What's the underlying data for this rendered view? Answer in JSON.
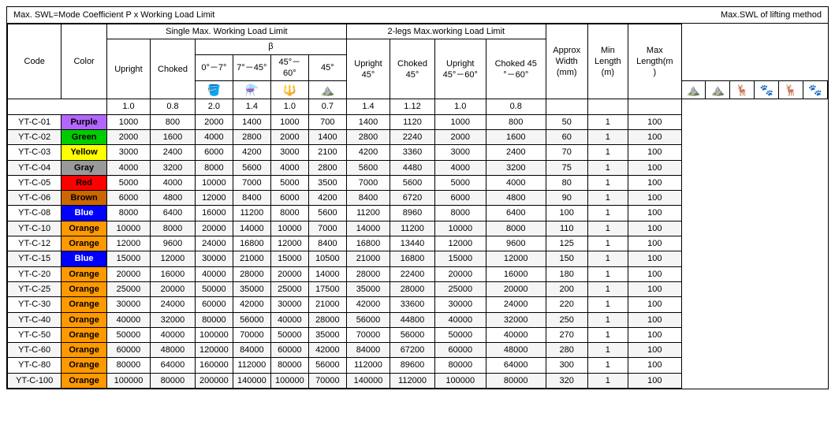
{
  "title_left": "Max. SWL=Mode Coefficient P x Working Load Limit",
  "title_right": "Max.SWL of lifting method",
  "headers": {
    "code": "Code",
    "color": "Color",
    "single_max": "Single Max. Working Load Limit",
    "two_legs": "2-legs Max.working Load Limit",
    "beta": "β",
    "upright": "Upright",
    "choked": "Choked",
    "upright_45": "Upright\n45°",
    "choked_45": "Choked\n45°",
    "upright_45_60": "Upright\n45°－60°",
    "choked_45_60": "Choked 45\n°－60°",
    "approx_width": "Approx\nWidth\n(mm)",
    "min_length": "Min\nLength\n(m)",
    "max_length": "Max\nLength(m\n)"
  },
  "angle_headers": {
    "a1": "0°－7°",
    "a2": "7°－45°",
    "a3": "45°－60°",
    "a4": "45°"
  },
  "coefficients": {
    "upright": "1.0",
    "choked": "0.8",
    "a1": "2.0",
    "a2": "1.4",
    "a3": "1.0",
    "a4": "0.7",
    "up45": "1.4",
    "ch45": "1.12",
    "up4560": "1.0",
    "ch4560": "0.8"
  },
  "rows": [
    {
      "code": "YT-C-01",
      "color": "Purple",
      "color_class": "color-purple",
      "upright": "1000",
      "choked": "800",
      "a1": "2000",
      "a2": "1400",
      "a3": "1000",
      "a4": "700",
      "up45": "1400",
      "ch45": "1120",
      "up4560": "1000",
      "ch4560": "800",
      "width": "50",
      "min_len": "1",
      "max_len": "100"
    },
    {
      "code": "YT-C-02",
      "color": "Green",
      "color_class": "color-green",
      "upright": "2000",
      "choked": "1600",
      "a1": "4000",
      "a2": "2800",
      "a3": "2000",
      "a4": "1400",
      "up45": "2800",
      "ch45": "2240",
      "up4560": "2000",
      "ch4560": "1600",
      "width": "60",
      "min_len": "1",
      "max_len": "100"
    },
    {
      "code": "YT-C-03",
      "color": "Yellow",
      "color_class": "color-yellow",
      "upright": "3000",
      "choked": "2400",
      "a1": "6000",
      "a2": "4200",
      "a3": "3000",
      "a4": "2100",
      "up45": "4200",
      "ch45": "3360",
      "up4560": "3000",
      "ch4560": "2400",
      "width": "70",
      "min_len": "1",
      "max_len": "100"
    },
    {
      "code": "YT-C-04",
      "color": "Gray",
      "color_class": "color-gray",
      "upright": "4000",
      "choked": "3200",
      "a1": "8000",
      "a2": "5600",
      "a3": "4000",
      "a4": "2800",
      "up45": "5600",
      "ch45": "4480",
      "up4560": "4000",
      "ch4560": "3200",
      "width": "75",
      "min_len": "1",
      "max_len": "100"
    },
    {
      "code": "YT-C-05",
      "color": "Red",
      "color_class": "color-red",
      "upright": "5000",
      "choked": "4000",
      "a1": "10000",
      "a2": "7000",
      "a3": "5000",
      "a4": "3500",
      "up45": "7000",
      "ch45": "5600",
      "up4560": "5000",
      "ch4560": "4000",
      "width": "80",
      "min_len": "1",
      "max_len": "100"
    },
    {
      "code": "YT-C-06",
      "color": "Brown",
      "color_class": "color-brown",
      "upright": "6000",
      "choked": "4800",
      "a1": "12000",
      "a2": "8400",
      "a3": "6000",
      "a4": "4200",
      "up45": "8400",
      "ch45": "6720",
      "up4560": "6000",
      "ch4560": "4800",
      "width": "90",
      "min_len": "1",
      "max_len": "100"
    },
    {
      "code": "YT-C-08",
      "color": "Blue",
      "color_class": "color-blue",
      "upright": "8000",
      "choked": "6400",
      "a1": "16000",
      "a2": "11200",
      "a3": "8000",
      "a4": "5600",
      "up45": "11200",
      "ch45": "8960",
      "up4560": "8000",
      "ch4560": "6400",
      "width": "100",
      "min_len": "1",
      "max_len": "100"
    },
    {
      "code": "YT-C-10",
      "color": "Orange",
      "color_class": "color-orange",
      "upright": "10000",
      "choked": "8000",
      "a1": "20000",
      "a2": "14000",
      "a3": "10000",
      "a4": "7000",
      "up45": "14000",
      "ch45": "11200",
      "up4560": "10000",
      "ch4560": "8000",
      "width": "110",
      "min_len": "1",
      "max_len": "100"
    },
    {
      "code": "YT-C-12",
      "color": "Orange",
      "color_class": "color-orange",
      "upright": "12000",
      "choked": "9600",
      "a1": "24000",
      "a2": "16800",
      "a3": "12000",
      "a4": "8400",
      "up45": "16800",
      "ch45": "13440",
      "up4560": "12000",
      "ch4560": "9600",
      "width": "125",
      "min_len": "1",
      "max_len": "100"
    },
    {
      "code": "YT-C-15",
      "color": "Blue",
      "color_class": "color-blue",
      "upright": "15000",
      "choked": "12000",
      "a1": "30000",
      "a2": "21000",
      "a3": "15000",
      "a4": "10500",
      "up45": "21000",
      "ch45": "16800",
      "up4560": "15000",
      "ch4560": "12000",
      "width": "150",
      "min_len": "1",
      "max_len": "100"
    },
    {
      "code": "YT-C-20",
      "color": "Orange",
      "color_class": "color-orange",
      "upright": "20000",
      "choked": "16000",
      "a1": "40000",
      "a2": "28000",
      "a3": "20000",
      "a4": "14000",
      "up45": "28000",
      "ch45": "22400",
      "up4560": "20000",
      "ch4560": "16000",
      "width": "180",
      "min_len": "1",
      "max_len": "100"
    },
    {
      "code": "YT-C-25",
      "color": "Orange",
      "color_class": "color-orange",
      "upright": "25000",
      "choked": "20000",
      "a1": "50000",
      "a2": "35000",
      "a3": "25000",
      "a4": "17500",
      "up45": "35000",
      "ch45": "28000",
      "up4560": "25000",
      "ch4560": "20000",
      "width": "200",
      "min_len": "1",
      "max_len": "100"
    },
    {
      "code": "YT-C-30",
      "color": "Orange",
      "color_class": "color-orange",
      "upright": "30000",
      "choked": "24000",
      "a1": "60000",
      "a2": "42000",
      "a3": "30000",
      "a4": "21000",
      "up45": "42000",
      "ch45": "33600",
      "up4560": "30000",
      "ch4560": "24000",
      "width": "220",
      "min_len": "1",
      "max_len": "100"
    },
    {
      "code": "YT-C-40",
      "color": "Orange",
      "color_class": "color-orange",
      "upright": "40000",
      "choked": "32000",
      "a1": "80000",
      "a2": "56000",
      "a3": "40000",
      "a4": "28000",
      "up45": "56000",
      "ch45": "44800",
      "up4560": "40000",
      "ch4560": "32000",
      "width": "250",
      "min_len": "1",
      "max_len": "100"
    },
    {
      "code": "YT-C-50",
      "color": "Orange",
      "color_class": "color-orange",
      "upright": "50000",
      "choked": "40000",
      "a1": "100000",
      "a2": "70000",
      "a3": "50000",
      "a4": "35000",
      "up45": "70000",
      "ch45": "56000",
      "up4560": "50000",
      "ch4560": "40000",
      "width": "270",
      "min_len": "1",
      "max_len": "100"
    },
    {
      "code": "YT-C-60",
      "color": "Orange",
      "color_class": "color-orange",
      "upright": "60000",
      "choked": "48000",
      "a1": "120000",
      "a2": "84000",
      "a3": "60000",
      "a4": "42000",
      "up45": "84000",
      "ch45": "67200",
      "up4560": "60000",
      "ch4560": "48000",
      "width": "280",
      "min_len": "1",
      "max_len": "100"
    },
    {
      "code": "YT-C-80",
      "color": "Orange",
      "color_class": "color-orange",
      "upright": "80000",
      "choked": "64000",
      "a1": "160000",
      "a2": "112000",
      "a3": "80000",
      "a4": "56000",
      "up45": "112000",
      "ch45": "89600",
      "up4560": "80000",
      "ch4560": "64000",
      "width": "300",
      "min_len": "1",
      "max_len": "100"
    },
    {
      "code": "YT-C-100",
      "color": "Orange",
      "color_class": "color-orange",
      "upright": "100000",
      "choked": "80000",
      "a1": "200000",
      "a2": "140000",
      "a3": "100000",
      "a4": "70000",
      "up45": "140000",
      "ch45": "112000",
      "up4560": "100000",
      "ch4560": "80000",
      "width": "320",
      "min_len": "1",
      "max_len": "100"
    }
  ]
}
